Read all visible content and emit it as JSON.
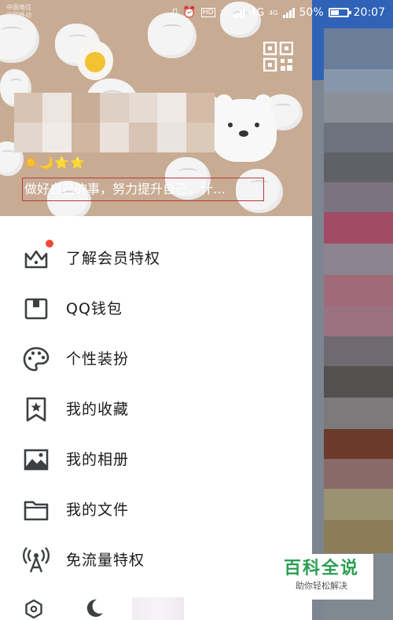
{
  "status": {
    "carrier1": "中国电信",
    "carrier2": "中国移动",
    "net1": "2G",
    "net2": "4G",
    "net3": "4G",
    "hd": "HD",
    "battery": "50%",
    "battery_level": 0.5,
    "time": "20:07"
  },
  "profile": {
    "level_badges": "☀️🌙⭐⭐",
    "signature": "做好自己的事，努力提升自己。什…"
  },
  "menu": [
    {
      "label": "了解会员特权",
      "icon": "crown-icon"
    },
    {
      "label": "QQ钱包",
      "icon": "wallet-icon"
    },
    {
      "label": "个性装扮",
      "icon": "palette-icon"
    },
    {
      "label": "我的收藏",
      "icon": "bookmark-star-icon"
    },
    {
      "label": "我的相册",
      "icon": "image-icon"
    },
    {
      "label": "我的文件",
      "icon": "folder-icon"
    },
    {
      "label": "免流量特权",
      "icon": "broadcast-icon"
    }
  ],
  "watermark": {
    "title": "百科全说",
    "subtitle": "助你轻松解决"
  },
  "colors": {
    "header_bg": "#c8ab93",
    "badge_red": "#f04a3b",
    "signature_border": "#b53a3a",
    "icon": "#3c4043"
  }
}
